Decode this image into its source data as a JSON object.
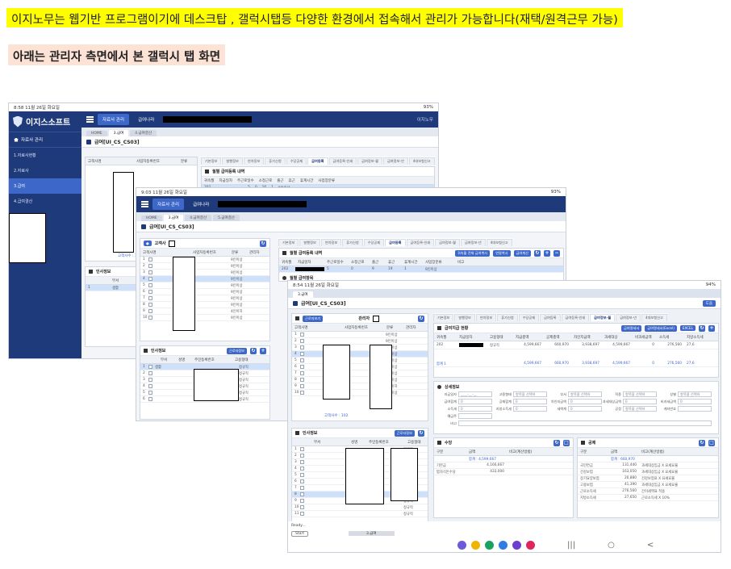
{
  "headline": "이지노무는 웹기반 프로그램이기에 데스크탑 , 갤럭시탭등 다양한 환경에서 접속해서 관리가 가능합니다(재택/원격근무 가능)",
  "subheadline": "아래는 관리자 측면에서 본 갤럭시 탭 화면",
  "tablet1": {
    "status_time": "8:58  11월 26일 화요일",
    "status_right": "93%",
    "logo": "이지스소프트",
    "side_title": "자료사 관리",
    "side_items": [
      "1.자료사현황",
      "2.자료사",
      "3.급여",
      "4.급여결산"
    ],
    "top_tabs": [
      "자료사 관리",
      "급여나라"
    ],
    "user": "이지노무",
    "subtabs": [
      "HOME",
      "3.급여",
      "4.급여결산"
    ],
    "title": "급여[UI_CS_CS03]",
    "page_tabs": [
      "기본정보",
      "발행정보",
      "연차정보",
      "휴가신청",
      "수당공제",
      "급여등록",
      "급여등록-인쇄",
      "급여정보-월",
      "급여정보-년",
      "4대보험신고"
    ],
    "panel_title": "월별 급여등록 내역",
    "panel_cols": [
      "귀속월",
      "지급일자",
      "주근로일수",
      "소정근로",
      "출근",
      "휴근",
      "휴계시간",
      "사업장분류"
    ],
    "panel_row": [
      "202",
      "",
      "5",
      "0",
      "16",
      "1",
      "9인이상"
    ],
    "left_head": [
      "고객사명",
      "사업자등록번호",
      "분류"
    ],
    "count": "고객사수 : 102",
    "hr_title": "인사정보",
    "hr_cols": [
      "부서"
    ],
    "hr_first": "생활"
  },
  "tablet2": {
    "status_time": "9:03  11월 26일 화요일",
    "status_right": "93%",
    "top_tabs": [
      "자료사 관리",
      "급여나라"
    ],
    "subtabs": [
      "HOME",
      "3.급여",
      "4.급여결산",
      "5.급여결산"
    ],
    "title": "급여[UI_CS_CS03]",
    "search_label": "고객사",
    "page_tabs": [
      "기본정보",
      "발행정보",
      "연차정보",
      "휴가신청",
      "수당공제",
      "급여등록",
      "급여등록-인쇄",
      "급여정보-월",
      "급여정보-년",
      "4대보험신고"
    ],
    "panel_title": "월별 급여등록 내역",
    "panel_btns": [
      "귀속월 전체 급여복사",
      "연말복사",
      "급여계산"
    ],
    "panel_cols": [
      "귀속월",
      "지급일자",
      "주근로일수",
      "소정근로",
      "출근",
      "휴근",
      "휴계시간",
      "사업장분류",
      "비고"
    ],
    "panel_row": [
      "202",
      "",
      "5",
      "0",
      "9",
      "19",
      "1",
      "9인이상"
    ],
    "sub_title": "월별 급여항목",
    "left_head": [
      "고객사명",
      "사업자등록번호",
      "분류",
      "관리자"
    ],
    "left_kinds": [
      "9인이상",
      "9인이상",
      "9인이상",
      "9인이상",
      "9인이상",
      "9인이상",
      "9인이상",
      "9인이상",
      "4인이하",
      "9인이상"
    ],
    "count": "고객사수 : 102",
    "hr_title": "인사정보",
    "hr_btn": "근로자정보",
    "hr_cols": [
      "부서",
      "성명",
      "주민등록번호",
      "고용형태"
    ],
    "hr_first": "생활",
    "hr_kinds": [
      "정규직",
      "정규직",
      "정규직",
      "정규직",
      "정규직",
      "정규직"
    ]
  },
  "tablet3": {
    "status_time": "8:54  11월 26일 화요일",
    "status_right": "94%",
    "subtab": "3.급여",
    "title": "급여[UI_CS_CS03]",
    "help": "도움",
    "search_btn": "근로자보기",
    "search_label": "관리자",
    "page_tabs": [
      "기본정보",
      "발행정보",
      "연차정보",
      "휴가신청",
      "수당공제",
      "급여등록",
      "급여등록-인쇄",
      "급여정보-월",
      "급여정보-년",
      "4대보험신고"
    ],
    "pay_title": "급여지급 현황",
    "pay_btns": [
      "급여명세서",
      "급여명세서(Excel)",
      "EXCEL"
    ],
    "pay_cols": [
      "귀속월",
      "지급일자",
      "고용형태",
      "지급총액",
      "공제총액",
      "차인지급액",
      "과세대상",
      "비과세금액",
      "소득세",
      "지방소득세"
    ],
    "pay_row": [
      "202",
      "",
      "정규직",
      "4,599,667",
      "660,970",
      "3,938,697",
      "4,599,667",
      "0",
      "276,560",
      "27,6"
    ],
    "pay_total": [
      "합계 1",
      "4,599,667",
      "660,970",
      "3,938,697",
      "4,599,667",
      "0",
      "276,560",
      "27,6"
    ],
    "detail_title": "상세정보",
    "detail_fields": [
      {
        "label": "지급일자",
        "value": "____-__-__"
      },
      {
        "label": "고용형태",
        "value": "항목을 선택하"
      },
      {
        "label": "부서",
        "value": "항목을 선택하"
      },
      {
        "label": "직종",
        "value": "항목을 선택하"
      },
      {
        "label": "성별",
        "value": "항목을 선택하"
      },
      {
        "label": "급여합계",
        "value": "0"
      },
      {
        "label": "공제합계",
        "value": "0"
      },
      {
        "label": "차인지급액",
        "value": "0"
      },
      {
        "label": "과세대상금액",
        "value": "0"
      },
      {
        "label": "비과세금액",
        "value": "0"
      },
      {
        "label": "소득세",
        "value": "0"
      },
      {
        "label": "지방소득세",
        "value": "0"
      },
      {
        "label": "세액계",
        "value": "0"
      },
      {
        "label": "공정",
        "value": "항목을 선택하"
      },
      {
        "label": "계좌번호",
        "value": ""
      },
      {
        "label": "예금주",
        "value": ""
      },
      {
        "label": "비고",
        "value": ""
      }
    ],
    "left_head": [
      "고객사명",
      "사업자등록번호",
      "분류",
      "관리자"
    ],
    "left_kinds": [
      "9인이상",
      "9인이상",
      "9인이상",
      "9인이상",
      "9인이상",
      "9인이상",
      "9인이상",
      "9인이상",
      "4인이하",
      "9인이상"
    ],
    "count": "고객사수 : 102",
    "hr_title": "인사정보",
    "hr_btn": "근로자정보",
    "hr_cols": [
      "부서",
      "성명",
      "주민등록번호",
      "고용형태"
    ],
    "hr_kinds": [
      "정규직",
      "정규직",
      "정규직",
      "정규직",
      "정규직",
      "정규직",
      "정규직",
      "정규직",
      "정규직",
      "정규직",
      "정규직"
    ],
    "allow_title": "수당",
    "allow_cols": [
      "구분",
      "금액",
      "비고(계산방법)"
    ],
    "allow_total": "합계 : 4,599,667",
    "allow_rows": [
      {
        "name": "기본급",
        "amount": "4,166,667"
      },
      {
        "name": "밥자식돈수당",
        "amount": "433,000"
      }
    ],
    "ded_title": "공제",
    "ded_cols": [
      "구분",
      "금액",
      "비고(계산방법)"
    ],
    "ded_total": "합계 : 660,970",
    "ded_rows": [
      {
        "name": "국민연금",
        "amount": "131,440",
        "note": "과세대상임금 X 요세요율"
      },
      {
        "name": "건강보험",
        "amount": "163,050",
        "note": "과세대상임금 X 요세요율"
      },
      {
        "name": "장기요양보험",
        "amount": "20,880",
        "note": "건강보험료 X 요세요율"
      },
      {
        "name": "고용보험",
        "amount": "41,390",
        "note": "과세대상임금 X 요세요율"
      },
      {
        "name": "근로소득세",
        "amount": "276,560",
        "note": "간이세액표 적용"
      },
      {
        "name": "지방소득세",
        "amount": "27,650",
        "note": "근로소득세 X 10%"
      }
    ],
    "footer_status": "Ready...",
    "footer_start": "Start",
    "footer_task": "3.급여",
    "nav_keys": [
      "|||",
      "○",
      "<"
    ]
  },
  "dock_colors": [
    "#6b5bd6",
    "#f0b400",
    "#1aa260",
    "#2f7de1",
    "#6b3fd0",
    "#e0245e"
  ]
}
